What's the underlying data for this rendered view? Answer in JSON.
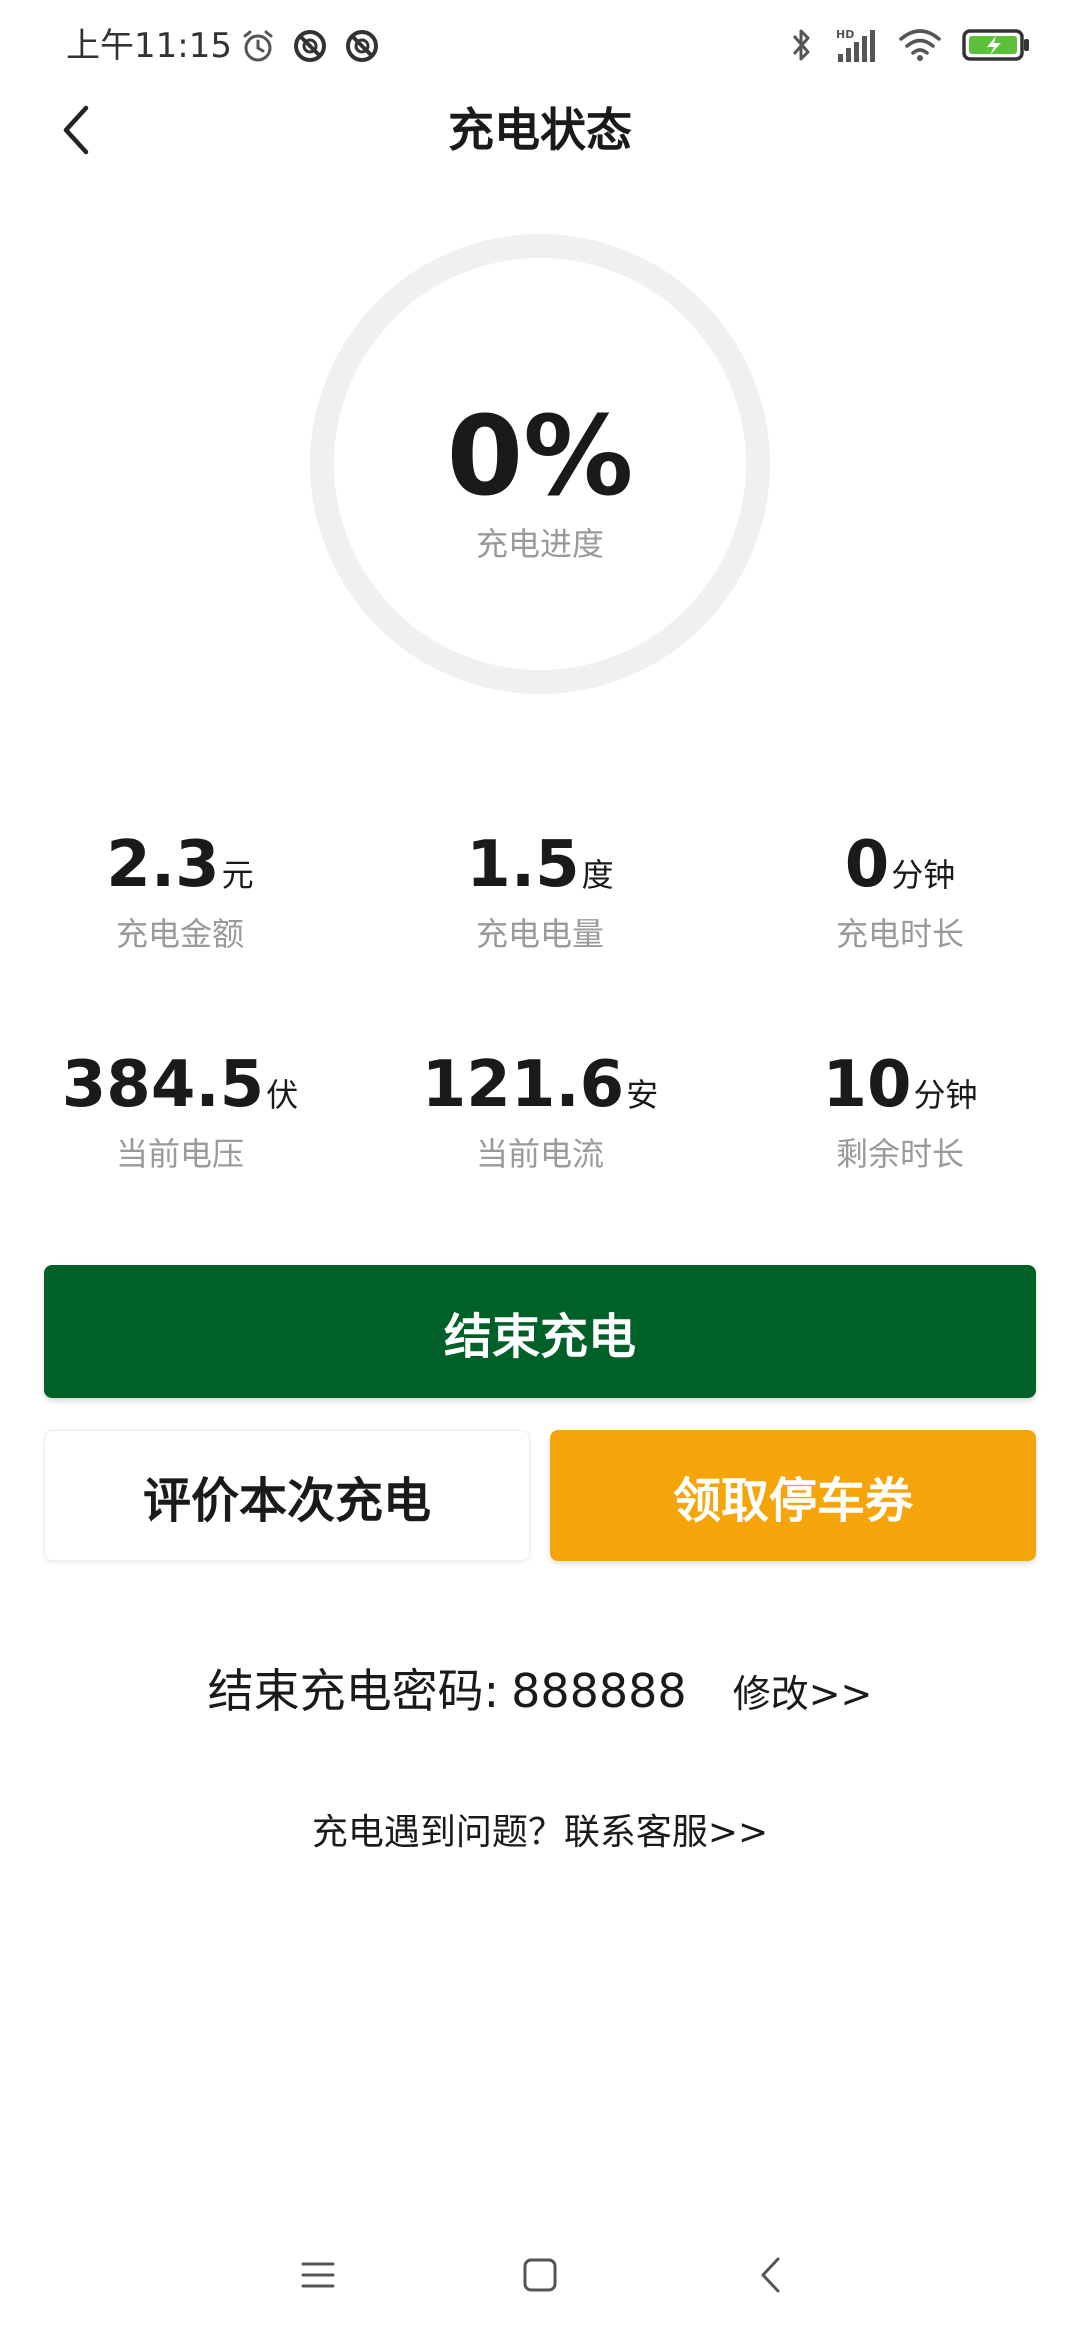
{
  "status_bar": {
    "time": "上午11:15",
    "left_icons": [
      "alarm-icon",
      "dnd-icon",
      "dnd-icon"
    ],
    "right_icons": [
      "bluetooth-icon",
      "hd-signal-icon",
      "wifi-icon",
      "battery-charging-icon"
    ]
  },
  "header": {
    "title": "充电状态",
    "back_icon": "chevron-left-icon"
  },
  "progress": {
    "value_text": "0%",
    "value": 0,
    "label": "充电进度",
    "track_color": "#f0f0f0"
  },
  "stats": [
    [
      {
        "number": "2.3",
        "unit": "元",
        "label": "充电金额"
      },
      {
        "number": "1.5",
        "unit": "度",
        "label": "充电电量"
      },
      {
        "number": "0",
        "unit": "分钟",
        "label": "充电时长"
      }
    ],
    [
      {
        "number": "384.5",
        "unit": "伏",
        "label": "当前电压"
      },
      {
        "number": "121.6",
        "unit": "安",
        "label": "当前电流"
      },
      {
        "number": "10",
        "unit": "分钟",
        "label": "剩余时长"
      }
    ]
  ],
  "actions": {
    "end_label": "结束充电",
    "rate_label": "评价本次充电",
    "coupon_label": "领取停车券"
  },
  "password": {
    "label": "结束充电密码:",
    "value": "888888",
    "modify_label": "修改>>"
  },
  "help": {
    "label": "充电遇到问题？联系客服>>"
  },
  "colors": {
    "primary_green": "#006128",
    "coupon_orange": "#f5a50a",
    "muted_text": "#9a9a9a"
  },
  "nav_bar": {
    "icons": [
      "menu-icon",
      "home-square-icon",
      "back-triangle-icon"
    ]
  }
}
